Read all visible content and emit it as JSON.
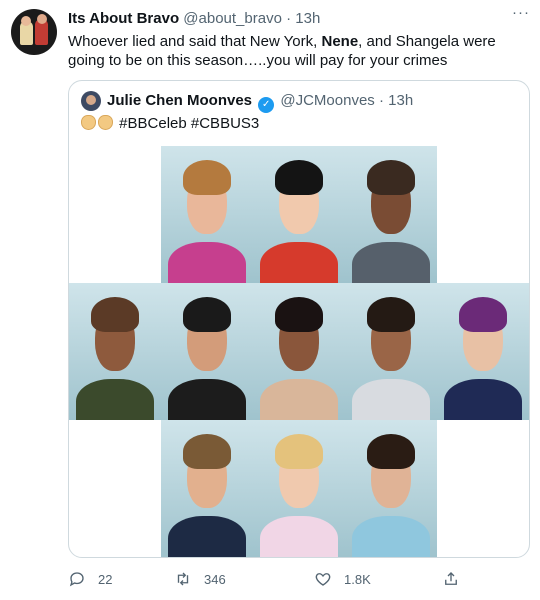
{
  "tweet": {
    "display_name": "Its About Bravo",
    "handle": "@about_bravo",
    "separator": "·",
    "time": "13h",
    "more": "···",
    "text_part1": "Whoever lied and said that New York, ",
    "text_bold": "Nene",
    "text_part2": ", and Shangela were going to be on this season…..you will pay for your crimes"
  },
  "quote": {
    "display_name": "Julie Chen Moonves",
    "verified_icon": "verified-badge-icon",
    "handle": "@JCMoonves",
    "separator": "·",
    "time": "13h",
    "hashtags": "#BBCeleb #CBBUS3",
    "emoji": [
      "clapping-hands-icon",
      "clapping-hands-icon"
    ]
  },
  "cast_photos": [
    {
      "skin": "#e9b79a",
      "hair": "#b47a3e",
      "shirt": "#c63f8e"
    },
    {
      "skin": "#f1c9ad",
      "hair": "#141414",
      "shirt": "#d63a2c"
    },
    {
      "skin": "#7a4c34",
      "hair": "#3a2a20",
      "shirt": "#56606b"
    },
    {
      "skin": "#8e5a3d",
      "hair": "#5b3a26",
      "shirt": "#3b4a2c"
    },
    {
      "skin": "#d39c7a",
      "hair": "#1a1a1a",
      "shirt": "#1c1c1c"
    },
    {
      "skin": "#8a563b",
      "hair": "#1a1212",
      "shirt": "#d9b69a"
    },
    {
      "skin": "#9a6547",
      "hair": "#241a14",
      "shirt": "#d8dbe0"
    },
    {
      "skin": "#e8c1a5",
      "hair": "#6b2a78",
      "shirt": "#1f2a55"
    },
    {
      "skin": "#e2b08e",
      "hair": "#7a5a36",
      "shirt": "#1d2a44"
    },
    {
      "skin": "#f0c9ae",
      "hair": "#e4c27c",
      "shirt": "#f1d6e6"
    },
    {
      "skin": "#e0b396",
      "hair": "#2a1c14",
      "shirt": "#8fc7de"
    }
  ],
  "actions": {
    "reply_count": "22",
    "retweet_count": "346",
    "like_count": "1.8K",
    "share_label": ""
  },
  "colors": {
    "verified": "#1d9bf0",
    "secondary_text": "#536471",
    "border": "#cfd9de"
  }
}
